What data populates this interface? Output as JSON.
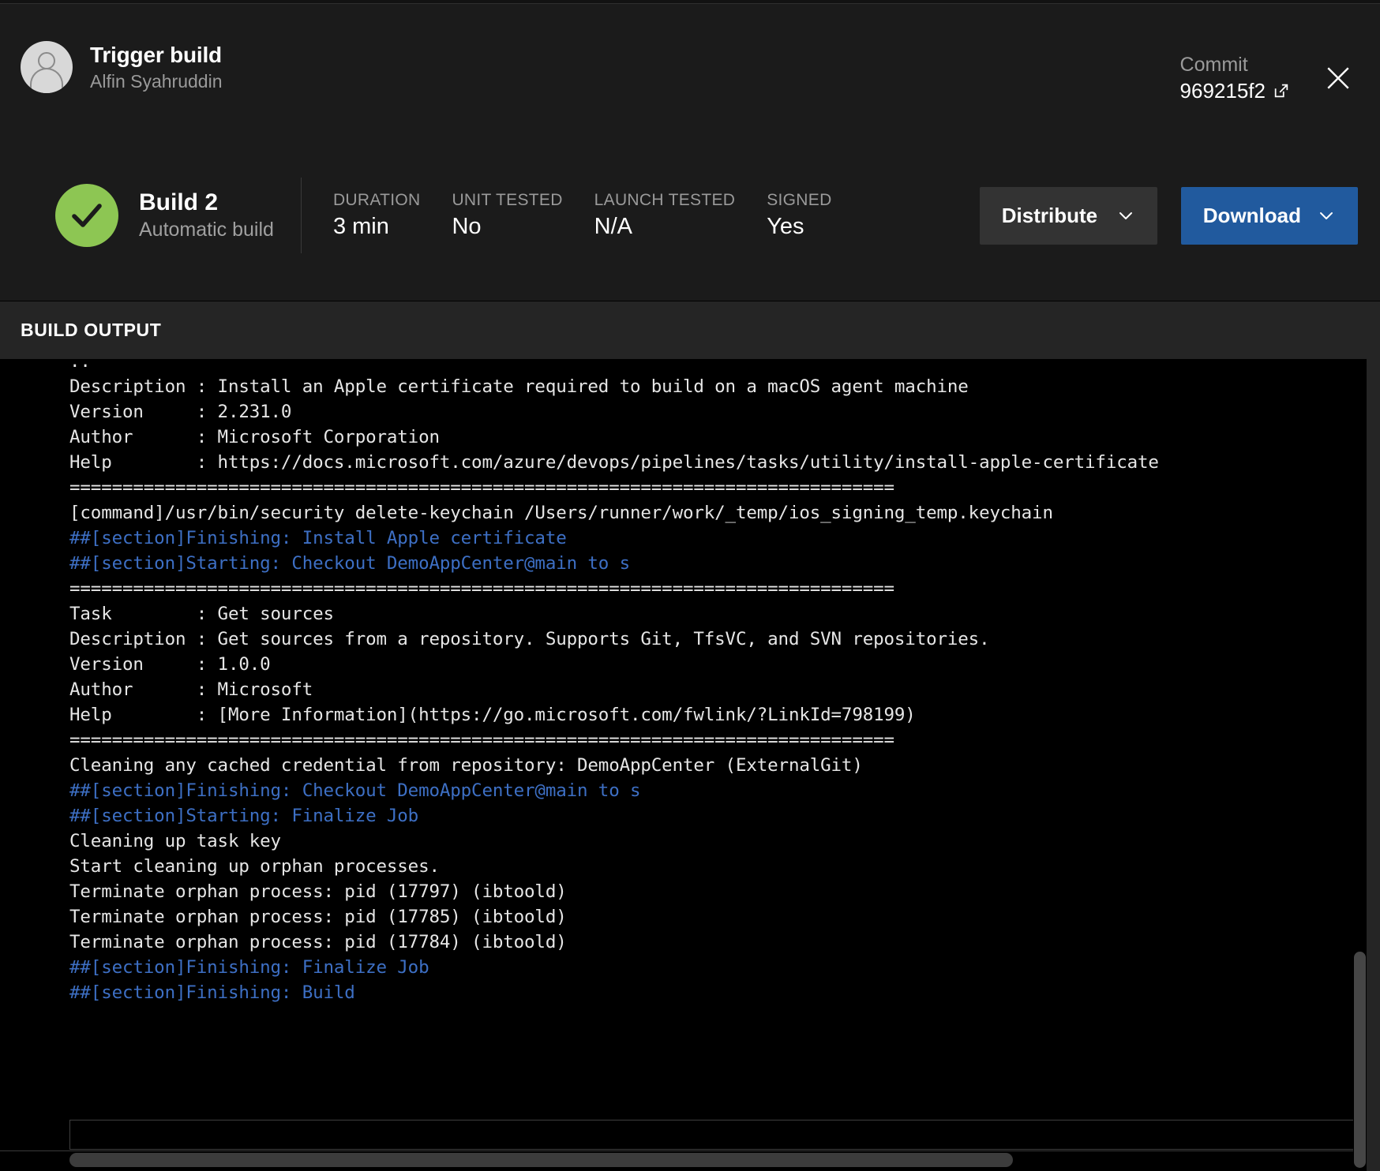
{
  "header": {
    "title": "Trigger build",
    "subtitle": "Alfin Syahruddin",
    "commit_label": "Commit",
    "commit_value": "969215f2",
    "external_link_icon": "external-link-icon",
    "close_icon": "close-icon",
    "avatar_icon": "user-avatar-icon"
  },
  "status": {
    "icon": "success-check-icon",
    "icon_color": "#8dc653",
    "build_name": "Build 2",
    "build_type": "Automatic build",
    "metrics": [
      {
        "label": "DURATION",
        "value": "3 min"
      },
      {
        "label": "UNIT TESTED",
        "value": "No"
      },
      {
        "label": "LAUNCH TESTED",
        "value": "N/A"
      },
      {
        "label": "SIGNED",
        "value": "Yes"
      }
    ],
    "distribute_label": "Distribute",
    "download_label": "Download",
    "chevron_icon": "chevron-down-icon",
    "primary_color": "#215a9e",
    "secondary_color": "#333333"
  },
  "output": {
    "section_title": "BUILD OUTPUT",
    "section_color": "#3d6fc4",
    "lines": [
      {
        "text": "..",
        "type": "plain"
      },
      {
        "text": "Description : Install an Apple certificate required to build on a macOS agent machine",
        "type": "plain"
      },
      {
        "text": "Version     : 2.231.0",
        "type": "plain"
      },
      {
        "text": "Author      : Microsoft Corporation",
        "type": "plain"
      },
      {
        "text": "Help        : https://docs.microsoft.com/azure/devops/pipelines/tasks/utility/install-apple-certificate",
        "type": "plain"
      },
      {
        "text": "==============================================================================",
        "type": "plain"
      },
      {
        "text": "[command]/usr/bin/security delete-keychain /Users/runner/work/_temp/ios_signing_temp.keychain",
        "type": "plain"
      },
      {
        "text": "##[section]Finishing: Install Apple certificate",
        "type": "section"
      },
      {
        "text": "##[section]Starting: Checkout DemoAppCenter@main to s",
        "type": "section"
      },
      {
        "text": "==============================================================================",
        "type": "plain"
      },
      {
        "text": "Task        : Get sources",
        "type": "plain"
      },
      {
        "text": "Description : Get sources from a repository. Supports Git, TfsVC, and SVN repositories.",
        "type": "plain"
      },
      {
        "text": "Version     : 1.0.0",
        "type": "plain"
      },
      {
        "text": "Author      : Microsoft",
        "type": "plain"
      },
      {
        "text": "Help        : [More Information](https://go.microsoft.com/fwlink/?LinkId=798199)",
        "type": "plain"
      },
      {
        "text": "==============================================================================",
        "type": "plain"
      },
      {
        "text": "Cleaning any cached credential from repository: DemoAppCenter (ExternalGit)",
        "type": "plain"
      },
      {
        "text": "##[section]Finishing: Checkout DemoAppCenter@main to s",
        "type": "section"
      },
      {
        "text": "##[section]Starting: Finalize Job",
        "type": "section"
      },
      {
        "text": "Cleaning up task key",
        "type": "plain"
      },
      {
        "text": "Start cleaning up orphan processes.",
        "type": "plain"
      },
      {
        "text": "Terminate orphan process: pid (17797) (ibtoold)",
        "type": "plain"
      },
      {
        "text": "Terminate orphan process: pid (17785) (ibtoold)",
        "type": "plain"
      },
      {
        "text": "Terminate orphan process: pid (17784) (ibtoold)",
        "type": "plain"
      },
      {
        "text": "##[section]Finishing: Finalize Job",
        "type": "section"
      },
      {
        "text": "##[section]Finishing: Build",
        "type": "section"
      }
    ]
  }
}
